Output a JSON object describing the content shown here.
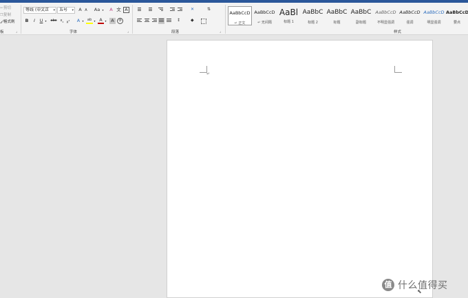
{
  "clipboard": {
    "items": [
      {
        "icon": "cut-icon",
        "label": "剪切"
      },
      {
        "icon": "copy-icon",
        "label": "复制"
      },
      {
        "icon": "format-painter-icon",
        "label": "格式刷"
      }
    ],
    "group_label": "板"
  },
  "font": {
    "family": "等线 (中文正",
    "size": "五号",
    "grow": "A",
    "shrink": "A",
    "change_case": "Aa",
    "clear_format": "A",
    "phonetic": "文",
    "border_char": "A",
    "bold": "B",
    "italic": "I",
    "underline": "U",
    "strike": "abc",
    "subscript": "x",
    "superscript": "x",
    "text_effects": "A",
    "highlight": "ab",
    "font_color": "A",
    "shading": "A",
    "encircle": "字",
    "group_label": "字体"
  },
  "paragraph": {
    "group_label": "段落"
  },
  "styles": {
    "group_label": "样式",
    "items": [
      {
        "preview": "AaBbCcD",
        "name": "↵ 正文",
        "selected": true
      },
      {
        "preview": "AaBbCcD",
        "name": "↵ 无间隔",
        "selected": false
      },
      {
        "preview": "AaBl",
        "name": "标题 1",
        "selected": false
      },
      {
        "preview": "AaBbC",
        "name": "标题 2",
        "selected": false
      },
      {
        "preview": "AaBbC",
        "name": "标题",
        "selected": false
      },
      {
        "preview": "AaBbC",
        "name": "副标题",
        "selected": false
      },
      {
        "preview": "AaBbCcD",
        "name": "不明显强调",
        "selected": false
      },
      {
        "preview": "AaBbCcD",
        "name": "强调",
        "selected": false
      },
      {
        "preview": "AaBbCcD",
        "name": "明显强调",
        "selected": false
      },
      {
        "preview": "AaBbCcD",
        "name": "要点",
        "selected": false
      }
    ]
  },
  "document": {
    "paragraph_mark": "↵"
  },
  "watermark": {
    "logo": "值",
    "text": "什么值得买"
  },
  "colors": {
    "title_bar": "#2b579a",
    "ribbon_bg": "#f3f3f3",
    "workspace_bg": "#e6e6e6",
    "font_color_swatch": "#c00000",
    "highlight_swatch": "#ffff00"
  }
}
